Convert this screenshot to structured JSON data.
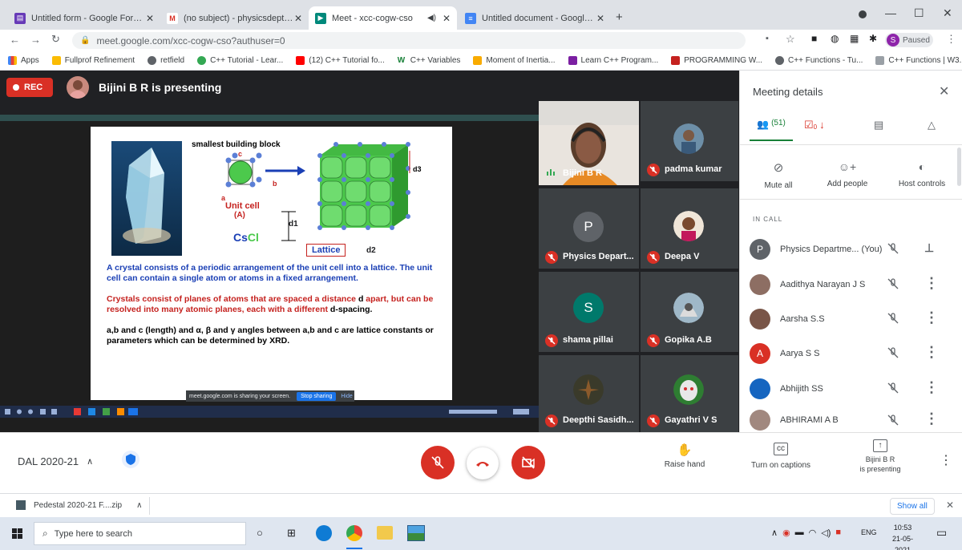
{
  "browser": {
    "tabs": [
      {
        "title": "Untitled form - Google Forms",
        "icon": "forms-icon"
      },
      {
        "title": "(no subject) - physicsdept@vtmn",
        "icon": "gmail-icon"
      },
      {
        "title": "Meet - xcc-cogw-cso",
        "icon": "meet-icon"
      },
      {
        "title": "Untitled document - Google Doc",
        "icon": "docs-icon"
      }
    ],
    "new_tab": "+",
    "url": "meet.google.com/xcc-cogw-cso?authuser=0",
    "profile_status": "Paused",
    "profile_initial": "S",
    "bookmarks": [
      "Apps",
      "Fullprof Refinement",
      "retfield",
      "C++ Tutorial - Lear...",
      "(12) C++ Tutorial fo...",
      "C++ Variables",
      "Moment of Inertia...",
      "Learn C++ Program...",
      "PROGRAMMING W...",
      "C++ Functions - Tu...",
      "C++ Functions | W3..."
    ]
  },
  "meet": {
    "rec_label": "REC",
    "presenting_title": "Bijini B R is presenting",
    "slide": {
      "heading": "smallest building block",
      "unit_cell_label": "Unit cell",
      "unit_cell_sub": "(A)",
      "formula_cs": "Cs",
      "formula_cl": "Cl",
      "lattice_label": "Lattice",
      "d1": "d1",
      "d2": "d2",
      "d3": "d3",
      "axis_a": "a",
      "axis_b": "b",
      "axis_c": "c",
      "para1": "A crystal consists of a periodic arrangement of the unit cell into a lattice. The unit cell can contain a single atom or atoms in a fixed arrangement.",
      "para2a": "Crystals consist of planes of atoms that are spaced a distance ",
      "para2d": "d",
      "para2b": " apart, but can be resolved into many atomic planes, each with a different ",
      "para2c": "d-spacing.",
      "para3": "a,b and c (length) and α, β and γ angles between a,b and c are lattice constants or parameters which can be determined by XRD.",
      "sharing_msg": "meet.google.com is sharing your screen.",
      "stop_sharing": "Stop sharing",
      "hide": "Hide"
    },
    "tiles": [
      {
        "name": "Bijini B R",
        "type": "video"
      },
      {
        "name": "padma kumar",
        "type": "photo"
      },
      {
        "name": "Physics Depart...",
        "type": "letter",
        "letter": "P",
        "color": "#5f6368"
      },
      {
        "name": "Deepa V",
        "type": "photo"
      },
      {
        "name": "shama pillai",
        "type": "letter",
        "letter": "S",
        "color": "#00796b"
      },
      {
        "name": "Gopika A.B",
        "type": "photo"
      },
      {
        "name": "Deepthi Sasidh...",
        "type": "photo"
      },
      {
        "name": "Gayathri V S",
        "type": "photo"
      }
    ]
  },
  "panel": {
    "title": "Meeting details",
    "people_count": "(51)",
    "activities_badge": "0",
    "actions": [
      "Mute all",
      "Add people",
      "Host controls"
    ],
    "in_call_label": "IN CALL",
    "participants": [
      {
        "name": "Physics Departme... (You)",
        "avatar": "P",
        "color": "#5f6368"
      },
      {
        "name": "Aadithya Narayan J S",
        "avatar": "",
        "color": "#8d6e63"
      },
      {
        "name": "Aarsha S.S",
        "avatar": "",
        "color": "#795548"
      },
      {
        "name": "Aarya S S",
        "avatar": "A",
        "color": "#d93025"
      },
      {
        "name": "Abhijith SS",
        "avatar": "",
        "color": "#1565c0"
      },
      {
        "name": "ABHIRAMI A B",
        "avatar": "",
        "color": "#a1887f"
      }
    ]
  },
  "controls": {
    "meeting_name": "DAL 2020-21",
    "raise_hand": "Raise hand",
    "captions": "Turn on captions",
    "presenting_line1": "Bijini B R",
    "presenting_line2": "is presenting"
  },
  "downloads": {
    "file": "Pedestal 2020-21 F....zip",
    "show_all": "Show all"
  },
  "taskbar": {
    "search_placeholder": "Type here to search",
    "lang": "ENG",
    "time": "10:53",
    "date": "21-05-2021"
  },
  "colors": {
    "red": "#d93025",
    "meet_bg": "#202124",
    "tile_bg": "#3c4043",
    "accent_green": "#188038"
  }
}
